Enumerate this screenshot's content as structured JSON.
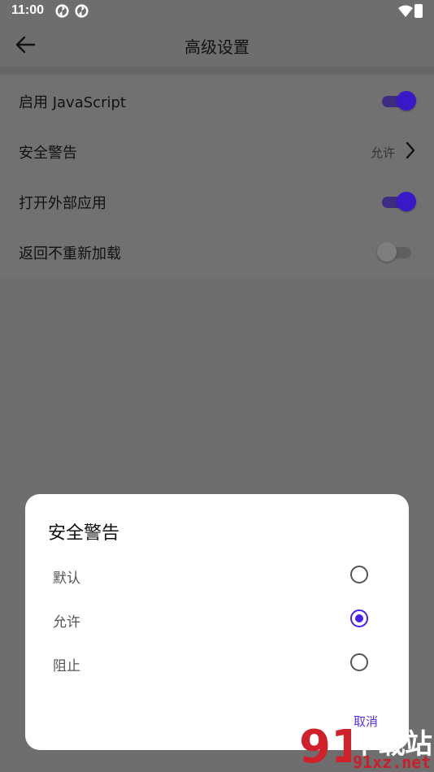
{
  "status_bar": {
    "time": "11:00",
    "notification_icons": [
      "sync-icon",
      "sync-icon"
    ],
    "wifi_icon": "wifi-icon",
    "battery_icon": "battery-charging-icon"
  },
  "app_bar": {
    "back_icon": "arrow-left-icon",
    "title": "高级设置"
  },
  "settings": [
    {
      "label": "启用 JavaScript",
      "type": "toggle",
      "on": true
    },
    {
      "label": "安全警告",
      "type": "value",
      "value": "允许",
      "icon": "chevron-right-icon"
    },
    {
      "label": "打开外部应用",
      "type": "toggle",
      "on": true
    },
    {
      "label": "返回不重新加载",
      "type": "toggle",
      "on": false
    }
  ],
  "dialog": {
    "title": "安全警告",
    "options": [
      {
        "label": "默认",
        "selected": false
      },
      {
        "label": "允许",
        "selected": true
      },
      {
        "label": "阻止",
        "selected": false
      }
    ],
    "cancel_label": "取消"
  },
  "watermark": {
    "logo_text": "下载站",
    "site": "91xz.net"
  },
  "colors": {
    "accent": "#4a1ff0",
    "toggle_track_on": "#3d2c82",
    "scrim": "#6e6e6e"
  }
}
